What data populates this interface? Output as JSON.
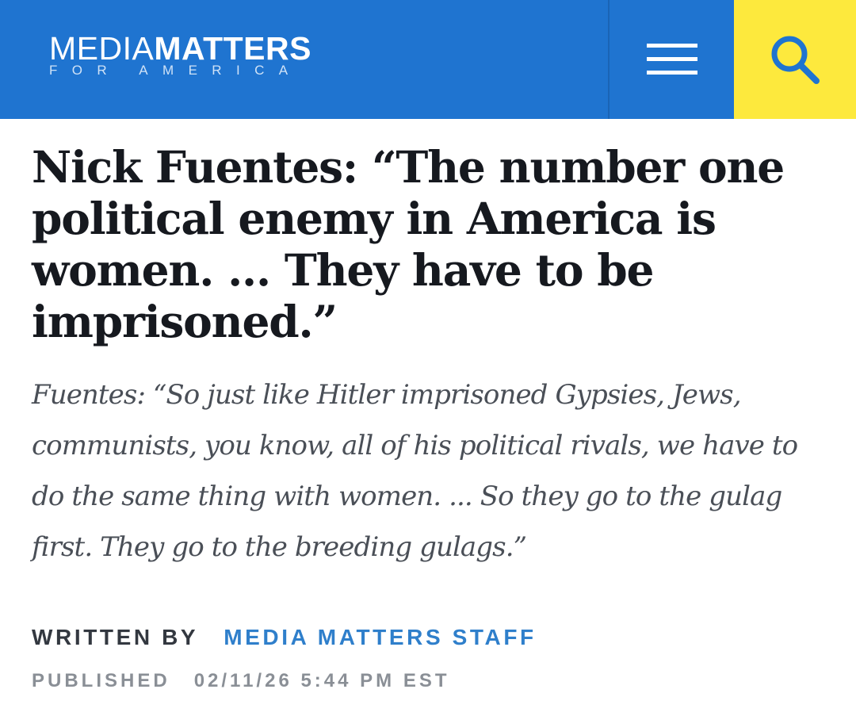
{
  "header": {
    "logo": {
      "light": "MEDIA",
      "bold": "MATTERS",
      "sub": "FOR AMERICA"
    },
    "menu_icon": "hamburger-menu-icon",
    "search_icon": "search-icon",
    "colors": {
      "header_bg": "#1f74d0",
      "search_bg": "#fde93d",
      "search_icon": "#1f74d0"
    }
  },
  "article": {
    "title": "Nick Fuentes: “The number one political enemy in America is women. ... They have to be imprisoned.”",
    "subtitle": "Fuentes: “So just like Hitler imprisoned Gypsies, Jews, communists, you know, all of his political rivals, we have to do the same thing with women. ... So they go to the gulag first. They go to the breeding gulags.”",
    "byline_label": "WRITTEN BY",
    "author": "MEDIA MATTERS STAFF",
    "published_label": "PUBLISHED",
    "published_date": "02/11/26 5:44 PM EST"
  }
}
